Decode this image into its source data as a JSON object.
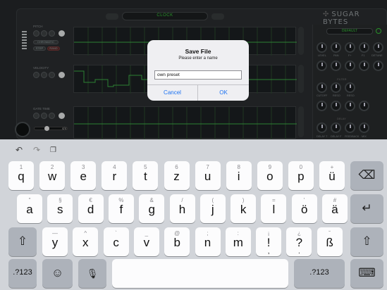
{
  "synth": {
    "header_label": "CLOCK",
    "brand": "SUGAR BYTES",
    "preset": "DEFAULT",
    "rows": [
      {
        "label": "PITCH",
        "chips": [
          "CHROMATIC",
          "STEP",
          "RAND"
        ]
      },
      {
        "label": "VELOCITY"
      },
      {
        "label": "GATE TIME"
      }
    ],
    "knob_labels_row1": [
      "LEVEL",
      "PAN",
      "F+",
      "F1",
      "DETUNE"
    ],
    "section_filter": "FILTER",
    "knob_labels_row2": [
      "CUTOFF",
      "RESO",
      "RESO"
    ],
    "section_delay": "DELAY",
    "knob_labels_row3": [
      "DELAY T",
      "DELAY F",
      "FEEDBACK",
      "MIX"
    ],
    "bottom_value": "4/4"
  },
  "dialog": {
    "title": "Save File",
    "message": "Please enter a name",
    "input_value": "own preset",
    "cancel": "Cancel",
    "ok": "OK"
  },
  "keyboard": {
    "toolbar_icons": [
      "undo-icon",
      "redo-icon",
      "paste-icon"
    ],
    "row1": [
      {
        "alt": "1",
        "main": "q"
      },
      {
        "alt": "2",
        "main": "w"
      },
      {
        "alt": "3",
        "main": "e"
      },
      {
        "alt": "4",
        "main": "r"
      },
      {
        "alt": "5",
        "main": "t"
      },
      {
        "alt": "6",
        "main": "z"
      },
      {
        "alt": "7",
        "main": "u"
      },
      {
        "alt": "8",
        "main": "i"
      },
      {
        "alt": "9",
        "main": "o"
      },
      {
        "alt": "0",
        "main": "p"
      },
      {
        "alt": "+",
        "main": "ü"
      }
    ],
    "row2": [
      {
        "alt": "\"",
        "main": "a"
      },
      {
        "alt": "§",
        "main": "s"
      },
      {
        "alt": "€",
        "main": "d"
      },
      {
        "alt": "%",
        "main": "f"
      },
      {
        "alt": "&",
        "main": "g"
      },
      {
        "alt": "/",
        "main": "h"
      },
      {
        "alt": "(",
        "main": "j"
      },
      {
        "alt": ")",
        "main": "k"
      },
      {
        "alt": "=",
        "main": "l"
      },
      {
        "alt": "'",
        "main": "ö"
      },
      {
        "alt": "#",
        "main": "ä"
      }
    ],
    "row3": [
      {
        "alt": "—",
        "main": "y"
      },
      {
        "alt": "^",
        "main": "x"
      },
      {
        "alt": "`",
        "main": "c"
      },
      {
        "alt": "_",
        "main": "v"
      },
      {
        "alt": "@",
        "main": "b"
      },
      {
        "alt": ";",
        "main": "n"
      },
      {
        "alt": ":",
        "main": "m"
      },
      {
        "alt": "¡",
        "main": "!"
      },
      {
        "alt": "¿",
        "main": "?"
      },
      {
        "alt": "˘",
        "main": "ß"
      }
    ],
    "row3_punct_low": [
      ",",
      "."
    ],
    "numbers_label": ".?123",
    "icons": {
      "backspace": "⌫",
      "return": "↵",
      "shift": "⇧",
      "emoji": "☺",
      "mic": "🎙",
      "hide": "⌨"
    }
  }
}
